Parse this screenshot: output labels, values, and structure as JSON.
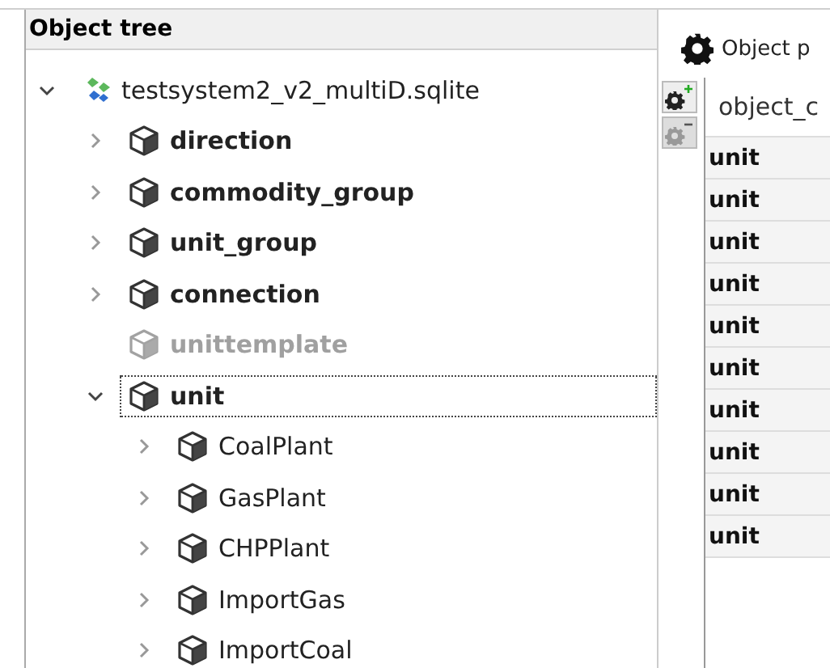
{
  "object_tree": {
    "title": "Object tree",
    "items": [
      {
        "label": "testsystem2_v2_multiD.sqlite",
        "kind": "database",
        "expandable": true,
        "expanded": true,
        "disabled": false,
        "focused": false,
        "children": [
          {
            "label": "direction",
            "kind": "class",
            "expandable": true,
            "expanded": false,
            "disabled": false,
            "focused": false
          },
          {
            "label": "commodity_group",
            "kind": "class",
            "expandable": true,
            "expanded": false,
            "disabled": false,
            "focused": false
          },
          {
            "label": "unit_group",
            "kind": "class",
            "expandable": true,
            "expanded": false,
            "disabled": false,
            "focused": false
          },
          {
            "label": "connection",
            "kind": "class",
            "expandable": true,
            "expanded": false,
            "disabled": false,
            "focused": false
          },
          {
            "label": "unittemplate",
            "kind": "class",
            "expandable": false,
            "expanded": false,
            "disabled": true,
            "focused": false
          },
          {
            "label": "unit",
            "kind": "class",
            "expandable": true,
            "expanded": true,
            "disabled": false,
            "focused": true,
            "children": [
              {
                "label": "CoalPlant",
                "kind": "object",
                "expandable": true,
                "expanded": false,
                "disabled": false,
                "focused": false
              },
              {
                "label": "GasPlant",
                "kind": "object",
                "expandable": true,
                "expanded": false,
                "disabled": false,
                "focused": false
              },
              {
                "label": "CHPPlant",
                "kind": "object",
                "expandable": true,
                "expanded": false,
                "disabled": false,
                "focused": false
              },
              {
                "label": "ImportGas",
                "kind": "object",
                "expandable": true,
                "expanded": false,
                "disabled": false,
                "focused": false
              },
              {
                "label": "ImportCoal",
                "kind": "object",
                "expandable": true,
                "expanded": false,
                "disabled": false,
                "focused": false
              }
            ]
          }
        ]
      }
    ]
  },
  "parameter_panel": {
    "tab": {
      "label": "Object p",
      "selected": true
    },
    "tools": [
      {
        "kind": "add",
        "disabled": false
      },
      {
        "kind": "remove",
        "disabled": true
      }
    ],
    "table": {
      "columns": [
        "object_c"
      ],
      "rows": [
        [
          "unit"
        ],
        [
          "unit"
        ],
        [
          "unit"
        ],
        [
          "unit"
        ],
        [
          "unit"
        ],
        [
          "unit"
        ],
        [
          "unit"
        ],
        [
          "unit"
        ],
        [
          "unit"
        ],
        [
          "unit"
        ]
      ]
    }
  }
}
